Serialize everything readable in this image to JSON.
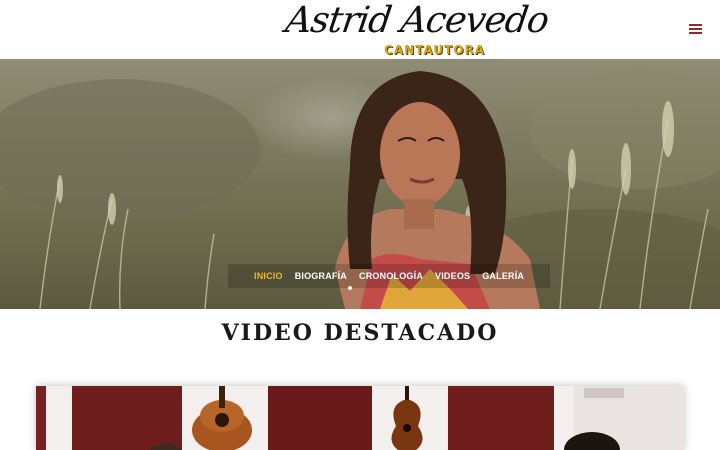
{
  "logo": {
    "name": "Astrid Acevedo",
    "tagline": "CANTAUTORA"
  },
  "header": {
    "menu_icon": "hamburger-menu-icon"
  },
  "hero": {
    "nav": [
      {
        "label": "INICIO",
        "active": true
      },
      {
        "label": "BIOGRAFÍA",
        "active": false
      },
      {
        "label": "CRONOLOGÍA",
        "active": false
      },
      {
        "label": "VIDEOS",
        "active": false
      },
      {
        "label": "GALERÍA",
        "active": false
      }
    ],
    "active_color": "#e8b926"
  },
  "featured": {
    "title": "VIDEO DESTACADO"
  },
  "colors": {
    "accent": "#d9a51a",
    "menu_icon": "#8b2d2d"
  }
}
